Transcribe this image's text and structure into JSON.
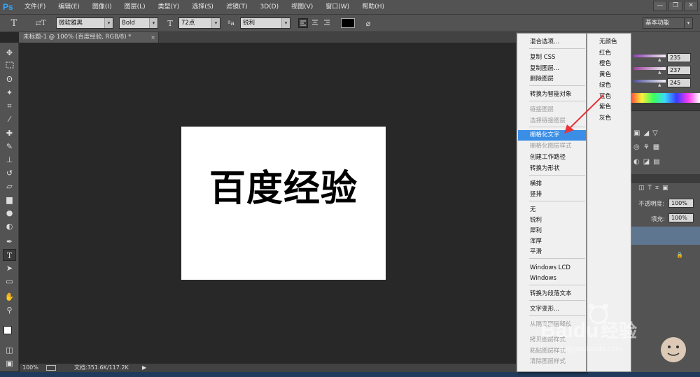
{
  "app": {
    "logo": "Ps"
  },
  "menubar": {
    "items": [
      "文件(F)",
      "编辑(E)",
      "图像(I)",
      "图层(L)",
      "类型(Y)",
      "选择(S)",
      "滤镜(T)",
      "3D(D)",
      "视图(V)",
      "窗口(W)",
      "帮助(H)"
    ],
    "window_buttons": [
      "—",
      "❐",
      "✕"
    ]
  },
  "options_bar": {
    "tool_icon": "T",
    "orient_icon": "⇄T",
    "font_family": "微软雅黑",
    "font_style": "Bold",
    "size_icon": "T",
    "font_size": "72点",
    "aa_icon": "ªa",
    "antialias": "锐利",
    "text_color": "#000000",
    "warp_icon": "⌀",
    "workspace": "基本功能"
  },
  "document": {
    "tab_title": "未标题-1 @ 100% (百度经验, RGB/8) *",
    "tab_close": "×",
    "canvas_text": "百度经验"
  },
  "statusbar": {
    "zoom": "100%",
    "doc_info": "文档:351.6K/117.2K",
    "arrow": "▶"
  },
  "right_panel": {
    "color_values": [
      "235",
      "237",
      "245"
    ],
    "opacity_label": "不透明度:",
    "opacity_value": "100%",
    "fill_label": "填充:",
    "fill_value": "100%",
    "lock_icon": "🔒"
  },
  "context_menu": {
    "items": [
      {
        "label": "混合选项...",
        "state": "normal"
      },
      {
        "label": "复制 CSS",
        "state": "normal"
      },
      {
        "label": "复制图层...",
        "state": "normal"
      },
      {
        "label": "删除图层",
        "state": "normal"
      },
      {
        "label": "转换为智能对象",
        "state": "normal"
      },
      {
        "label": "链接图层",
        "state": "disabled"
      },
      {
        "label": "选择链接图层",
        "state": "disabled"
      },
      {
        "label": "栅格化文字",
        "state": "selected"
      },
      {
        "label": "栅格化图层样式",
        "state": "disabled"
      },
      {
        "label": "创建工作路径",
        "state": "normal"
      },
      {
        "label": "转换为形状",
        "state": "normal"
      },
      {
        "label": "横排",
        "state": "normal"
      },
      {
        "label": "竖排",
        "state": "normal"
      },
      {
        "label": "无",
        "state": "normal"
      },
      {
        "label": "锐利",
        "state": "normal"
      },
      {
        "label": "犀利",
        "state": "normal"
      },
      {
        "label": "浑厚",
        "state": "normal"
      },
      {
        "label": "平滑",
        "state": "normal"
      },
      {
        "label": "Windows LCD",
        "state": "normal"
      },
      {
        "label": "Windows",
        "state": "normal"
      },
      {
        "label": "转换为段落文本",
        "state": "normal"
      },
      {
        "label": "文字变形...",
        "state": "normal"
      },
      {
        "label": "从隔离图层释放",
        "state": "disabled"
      },
      {
        "label": "拷贝图层样式",
        "state": "disabled"
      },
      {
        "label": "粘贴图层样式",
        "state": "disabled"
      },
      {
        "label": "清除图层样式",
        "state": "disabled"
      }
    ]
  },
  "color_submenu": {
    "items": [
      "无颜色",
      "红色",
      "橙色",
      "黄色",
      "绿色",
      "蓝色",
      "紫色",
      "灰色"
    ]
  },
  "watermark": {
    "brand": "Baidu",
    "suffix": "经验",
    "url": "jingyan.baidu.com"
  },
  "colors": {
    "accent": "#3b8ee6",
    "ps_blue": "#31a8ff",
    "arrow": "#e8343a"
  }
}
